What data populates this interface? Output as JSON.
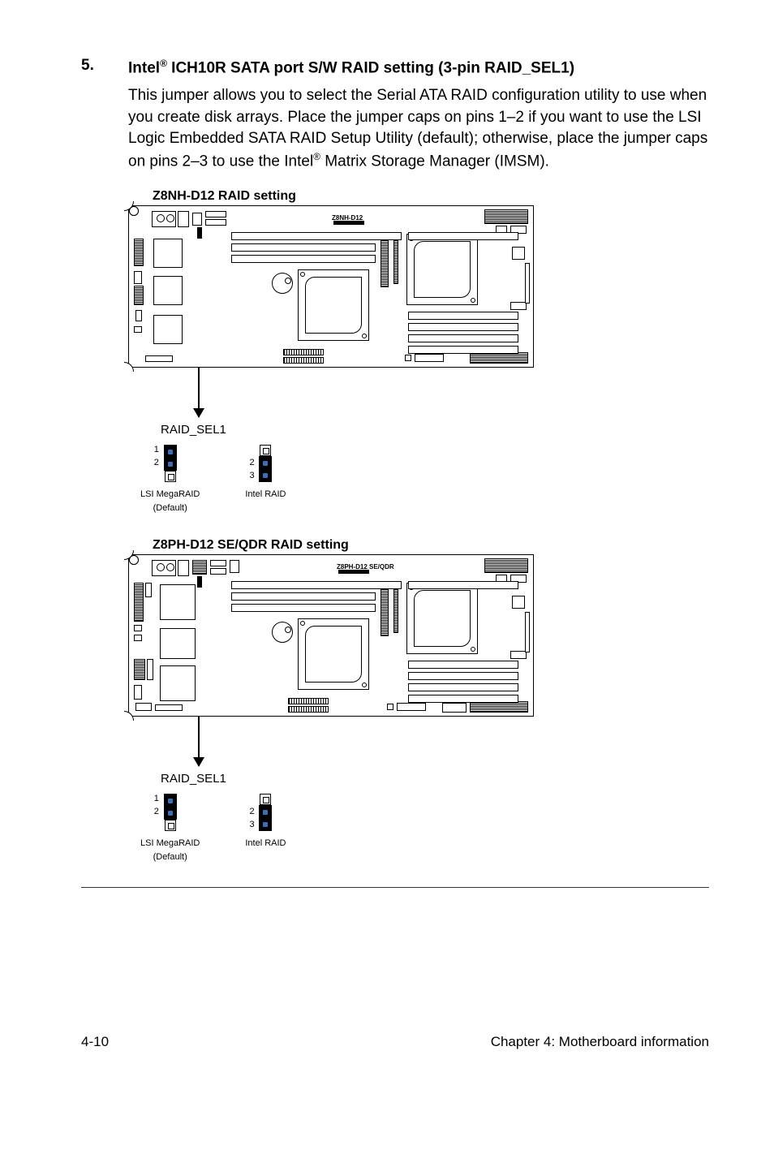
{
  "item": {
    "number": "5.",
    "title_prefix": "Intel",
    "title_reg": "®",
    "title_rest": " ICH10R SATA port S/W RAID setting (3-pin RAID_SEL1)"
  },
  "body": {
    "p1a": "This jumper allows you to select the Serial ATA RAID configuration utility to use when you create disk arrays. Place the jumper caps on pins 1–2 if you want to use the LSI Logic Embedded SATA RAID Setup Utility (default); otherwise, place the jumper caps on pins 2–3 to use the Intel",
    "p1reg": "®",
    "p1b": " Matrix Storage Manager (IMSM)."
  },
  "diagrams": {
    "d1": {
      "title": "Z8NH-D12 RAID setting",
      "board_label": "Z8NH-D12",
      "jumper_name": "RAID_SEL1",
      "opt1": "LSI MegaRAID",
      "opt1_sub": "(Default)",
      "opt2": "Intel RAID",
      "pins": {
        "n1": "1",
        "n2": "2",
        "n3": "3"
      }
    },
    "d2": {
      "title": "Z8PH-D12 SE/QDR RAID setting",
      "board_label": "Z8PH-D12 SE/QDR",
      "jumper_name": "RAID_SEL1",
      "opt1": "LSI MegaRAID",
      "opt1_sub": "(Default)",
      "opt2": "Intel RAID",
      "pins": {
        "n1": "1",
        "n2": "2",
        "n3": "3"
      }
    }
  },
  "footer": {
    "left": "4-10",
    "right": "Chapter 4: Motherboard information"
  }
}
